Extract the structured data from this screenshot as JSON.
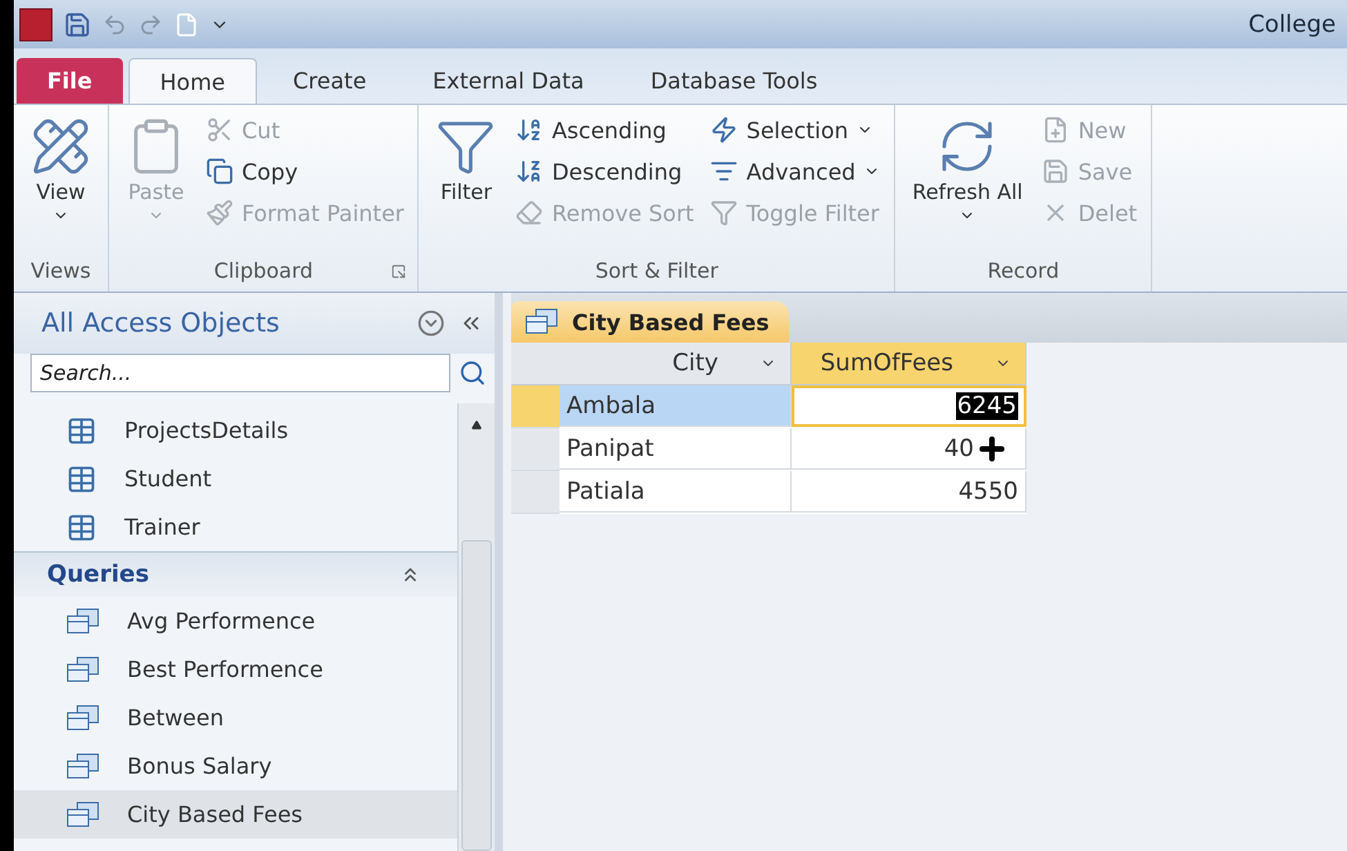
{
  "title_bar": {
    "title": "College"
  },
  "ribbon_tabs": [
    {
      "label": "File",
      "kind": "file"
    },
    {
      "label": "Home",
      "kind": "tab",
      "selected": true
    },
    {
      "label": "Create",
      "kind": "tab",
      "selected": false
    },
    {
      "label": "External Data",
      "kind": "tab",
      "selected": false
    },
    {
      "label": "Database Tools",
      "kind": "tab",
      "selected": false
    }
  ],
  "ribbon_groups": [
    {
      "label": "Views",
      "items": [
        {
          "label": "View",
          "kind": "large",
          "disabled": false,
          "dropdown": true
        }
      ]
    },
    {
      "label": "Clipboard",
      "launcher": true,
      "items": [
        {
          "label": "Paste",
          "kind": "large",
          "disabled": true,
          "dropdown": true
        },
        {
          "label": "Cut",
          "kind": "small",
          "disabled": true
        },
        {
          "label": "Copy",
          "kind": "small",
          "disabled": false
        },
        {
          "label": "Format Painter",
          "kind": "small",
          "disabled": true
        }
      ]
    },
    {
      "label": "Sort & Filter",
      "items": [
        {
          "label": "Filter",
          "kind": "large",
          "disabled": false
        },
        {
          "label": "Ascending",
          "kind": "small",
          "disabled": false
        },
        {
          "label": "Descending",
          "kind": "small",
          "disabled": false
        },
        {
          "label": "Remove Sort",
          "kind": "small",
          "disabled": true
        },
        {
          "label": "Selection",
          "kind": "small",
          "disabled": false,
          "dropdown": true
        },
        {
          "label": "Advanced",
          "kind": "small",
          "disabled": false,
          "dropdown": true
        },
        {
          "label": "Toggle Filter",
          "kind": "small",
          "disabled": true
        }
      ]
    },
    {
      "label": "Record",
      "items": [
        {
          "label": "Refresh All",
          "kind": "large",
          "disabled": false,
          "dropdown": true
        },
        {
          "label": "New",
          "kind": "small",
          "disabled": true
        },
        {
          "label": "Save",
          "kind": "small",
          "disabled": true
        },
        {
          "label": "Delet",
          "kind": "small",
          "disabled": true
        }
      ]
    }
  ],
  "navigation_pane": {
    "title": "All Access Objects",
    "search": {
      "placeholder": "Search..."
    },
    "items": [
      {
        "label": "ProjectsDetails",
        "kind": "table",
        "selected": false
      },
      {
        "label": "Student",
        "kind": "table",
        "selected": false
      },
      {
        "label": "Trainer",
        "kind": "table",
        "selected": false
      },
      {
        "label": "Queries",
        "kind": "group",
        "expanded": true
      },
      {
        "label": "Avg Performence",
        "kind": "query",
        "selected": false
      },
      {
        "label": "Best Performence",
        "kind": "query",
        "selected": false
      },
      {
        "label": "Between",
        "kind": "query",
        "selected": false
      },
      {
        "label": "Bonus Salary",
        "kind": "query",
        "selected": false
      },
      {
        "label": "City Based Fees",
        "kind": "query",
        "selected": true
      }
    ]
  },
  "document_tab": {
    "label": "City Based Fees",
    "selected": true
  },
  "datasheet": {
    "columns": [
      {
        "label": "City",
        "selected": false,
        "kind": "text"
      },
      {
        "label": "SumOfFees",
        "selected": true,
        "kind": "number"
      }
    ],
    "rows": [
      {
        "selected": true,
        "cells": [
          {
            "value": "Ambala",
            "selected": false
          },
          {
            "value": "6245",
            "selected": true
          }
        ]
      },
      {
        "selected": false,
        "cells": [
          {
            "value": "Panipat",
            "selected": false
          },
          {
            "value": "40",
            "selected": false
          }
        ]
      },
      {
        "selected": false,
        "cells": [
          {
            "value": "Patiala",
            "selected": false
          },
          {
            "value": "4550",
            "selected": false
          }
        ]
      }
    ]
  }
}
